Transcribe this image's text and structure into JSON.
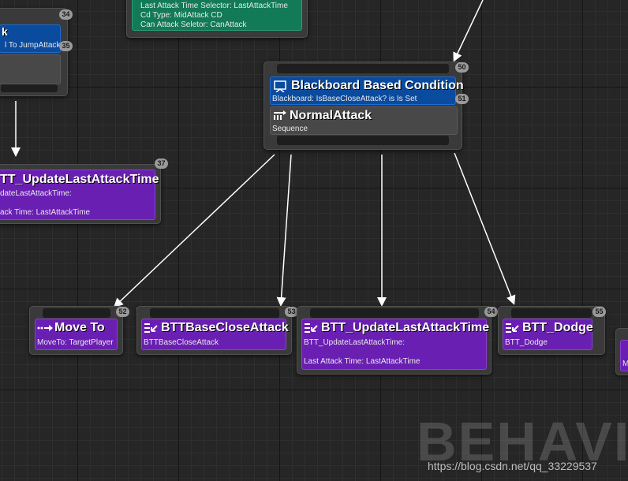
{
  "watermark": "BEHAVIO",
  "source_url": "https://blog.csdn.net/qq_33229537",
  "top_left_node": {
    "index": "34",
    "row_index": "35",
    "row_text": "l To JumpAttack",
    "row_prefix": "k"
  },
  "left_update_node": {
    "index": "37",
    "title": "TT_UpdateLastAttackTime",
    "line1": "dateLastAttackTime:",
    "line2": "ack Time: LastAttackTime"
  },
  "top_green_node": {
    "lines": [
      "Last Attack Time Selector: LastAttackTime",
      "Cd Type: MidAttack CD",
      "Can Attack Seletor: CanAttack"
    ]
  },
  "center_node": {
    "index": "50",
    "decorator_index": "51",
    "decorator_title": "Blackboard Based Condition",
    "decorator_sub": "Blackboard: IsBaseCloseAttack? is Is Set",
    "composite_title": "NormalAttack",
    "composite_sub": "Sequence"
  },
  "tasks": [
    {
      "index": "52",
      "title": "Move To",
      "sub": "MoveTo: TargetPlayer",
      "extra": ""
    },
    {
      "index": "53",
      "title": "BTTBaseCloseAttack",
      "sub": "BTTBaseCloseAttack",
      "extra": ""
    },
    {
      "index": "54",
      "title": "BTT_UpdateLastAttackTime",
      "sub": "BTT_UpdateLastAttackTime:",
      "extra": "Last Attack Time: LastAttackTime"
    },
    {
      "index": "55",
      "title": "BTT_Dodge",
      "sub": "BTT_Dodge",
      "extra": ""
    }
  ],
  "right_edge_node": {
    "sub": "M"
  },
  "colors": {
    "decorator_blue": "#0a4b9e",
    "task_purple": "#6a1fb3",
    "service_green": "#137a58",
    "node_grey": "#3a3a3a",
    "link": "#ffffff"
  }
}
